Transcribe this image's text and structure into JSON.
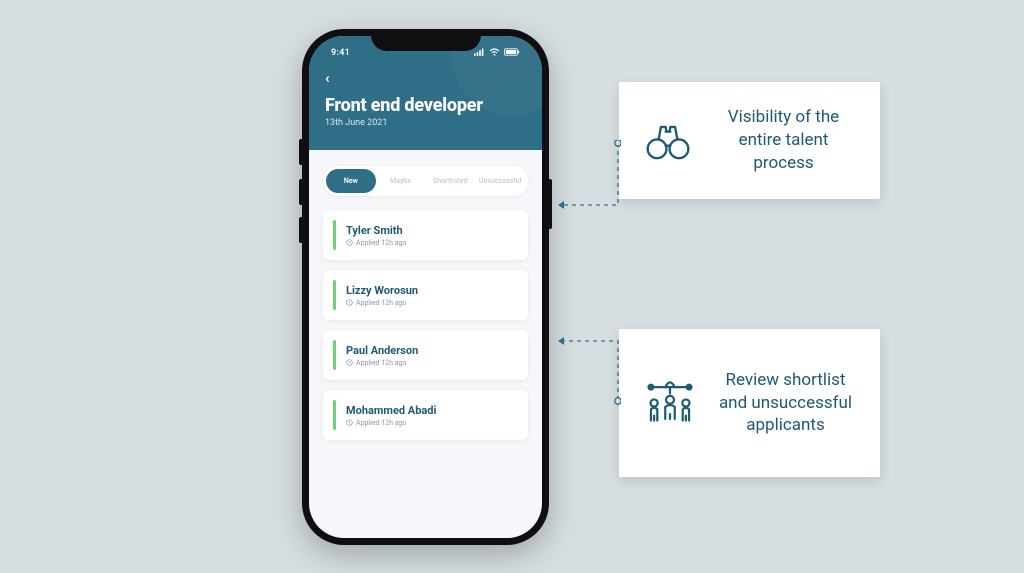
{
  "phone": {
    "statusbar": {
      "time": "9:41"
    },
    "back_label": "‹",
    "job_title": "Front end developer",
    "job_date": "13th June 2021",
    "tabs": [
      {
        "label": "New",
        "active": true
      },
      {
        "label": "Maybe",
        "active": false
      },
      {
        "label": "Shortlisted",
        "active": false
      },
      {
        "label": "Unsuccessful",
        "active": false
      }
    ],
    "applicants": [
      {
        "name": "Tyler Smith",
        "meta": "Applied 12h ago"
      },
      {
        "name": "Lizzy Worosun",
        "meta": "Applied 12h ago"
      },
      {
        "name": "Paul Anderson",
        "meta": "Applied 12h ago"
      },
      {
        "name": "Mohammed Abadi",
        "meta": "Applied 12h ago"
      }
    ]
  },
  "callouts": [
    {
      "text": "Visibility of the entire talent process"
    },
    {
      "text": "Review shortlist and unsuccessful applicants"
    }
  ]
}
